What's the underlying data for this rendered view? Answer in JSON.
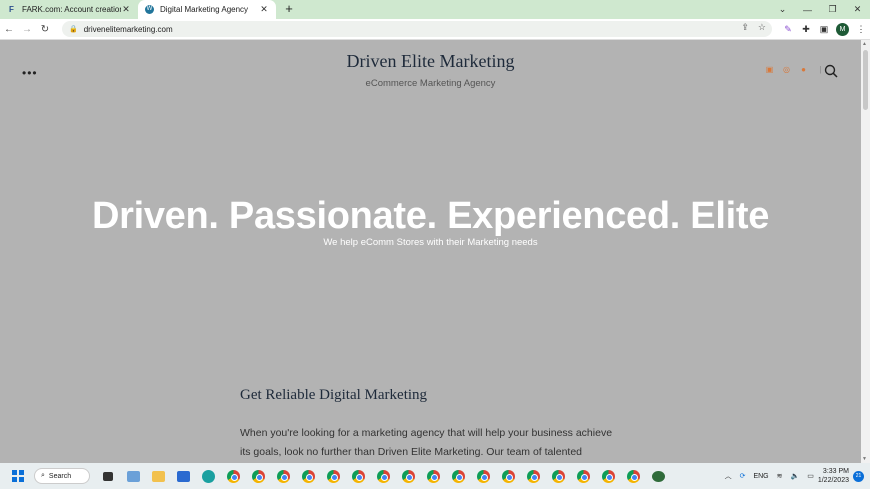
{
  "browser": {
    "tabs": [
      {
        "title": "FARK.com: Account creation",
        "favicon": "fark-icon",
        "active": false
      },
      {
        "title": "Digital Marketing Agency",
        "favicon": "wordpress-icon",
        "active": true
      }
    ],
    "url": "drivenelitemarketing.com"
  },
  "site": {
    "title": "Driven Elite Marketing",
    "tagline": "eCommerce Marketing Agency",
    "social": [
      "linkedin-icon",
      "instagram-icon",
      "facebook-icon"
    ],
    "accent_color": "#d8783a"
  },
  "hero": {
    "headline": "Driven. Passionate. Experienced. Elite",
    "subheadline": "We help eComm Stores with their Marketing needs"
  },
  "content": {
    "heading": "Get Reliable Digital Marketing",
    "paragraph": "When you're looking for a marketing agency that will help your business achieve its goals, look no further than Driven Elite Marketing. Our team of talented professionals is"
  },
  "taskbar": {
    "search_label": "Search",
    "chrome_badges": [
      "",
      "",
      "",
      "",
      "",
      "",
      "",
      "",
      "",
      "",
      "",
      "",
      "",
      "",
      "",
      "",
      ""
    ],
    "language": "ENG",
    "time": "3:33 PM",
    "date": "1/22/2023",
    "notification_count": "21"
  }
}
